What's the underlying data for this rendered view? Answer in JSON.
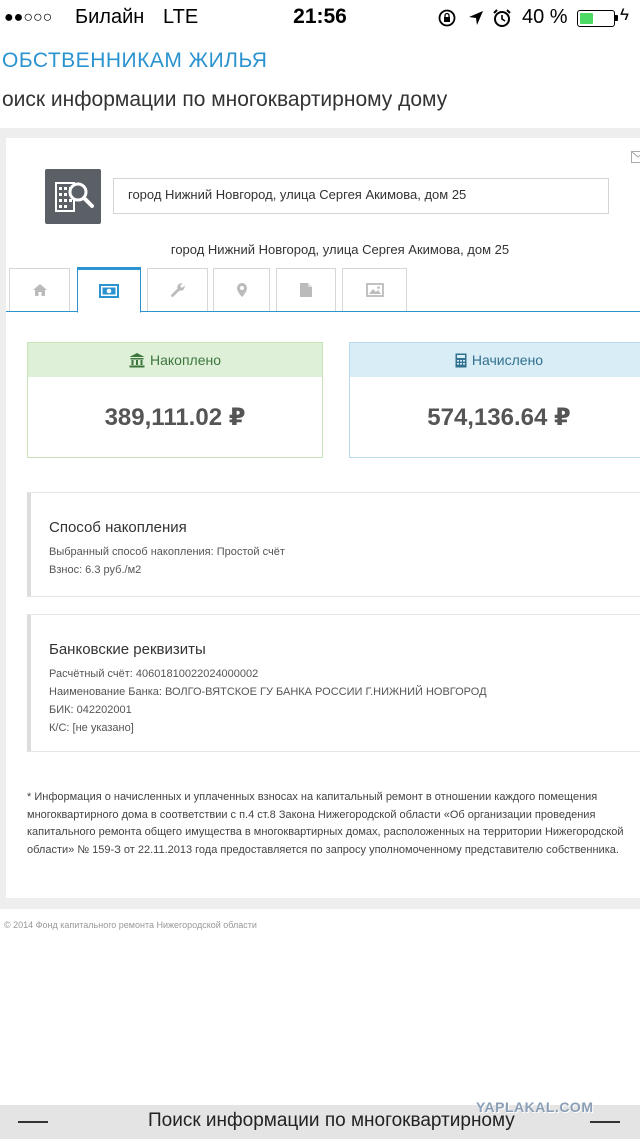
{
  "status_bar": {
    "signal": "●●○○○",
    "carrier": "Билайн",
    "network": "LTE",
    "time": "21:56",
    "icons": [
      "rotation-lock-icon",
      "location-arrow-icon",
      "alarm-icon"
    ],
    "battery_percent_label": "40 %",
    "battery_level": 0.4
  },
  "site_title": "ОБСТВЕННИКАМ ЖИЛЬЯ",
  "page_heading": "оиск информации по многоквартирному дому",
  "search": {
    "value": "город Нижний Новгород, улица Сергея Акимова, дом 25"
  },
  "address_caption": "город Нижний Новгород, улица Сергея Акимова, дом 25",
  "tabs": [
    {
      "icon": "home-icon",
      "active": false
    },
    {
      "icon": "money-icon",
      "active": true
    },
    {
      "icon": "wrench-icon",
      "active": false
    },
    {
      "icon": "map-marker-icon",
      "active": false
    },
    {
      "icon": "document-icon",
      "active": false
    },
    {
      "icon": "image-icon",
      "active": false
    }
  ],
  "stats": {
    "accumulated": {
      "label": "Накоплено",
      "value": "389,111.02 ₽",
      "icon": "bank-icon"
    },
    "charged": {
      "label": "Начислено",
      "value": "574,136.64 ₽",
      "icon": "calculator-icon"
    }
  },
  "accumulation": {
    "title": "Способ накопления",
    "lines": [
      "Выбранный способ накопления: Простой счёт",
      "Взнос: 6.3 руб./м2"
    ]
  },
  "bank": {
    "title": "Банковские реквизиты",
    "lines": [
      "Расчётный счёт: 40601810022024000002",
      "Наименование Банка: ВОЛГО-ВЯТСКОЕ ГУ БАНКА РОССИИ Г.НИЖНИЙ НОВГОРОД",
      "БИК: 042202001",
      "К/С: [не указано]"
    ]
  },
  "footnote": "* Информация о начисленных и уплаченных взносах на капитальный ремонт в отношении каждого помещения многоквартирного дома в соответствии с п.4 ст.8 Закона Нижегородской области «Об организации проведения капитального ремонта общего имущества в многоквартирных домах, расположенных на территории Нижегородской области» № 159-З от 22.11.2013 года предоставляется по запросу уполномоченному представителю собственника.",
  "copyright": "© 2014 Фонд капитального ремонта Нижегородской области",
  "bottom_bar": {
    "title": "Поиск информации по многоквартирному"
  },
  "watermark": "YAPLAKAL.COM",
  "colors": {
    "accent": "#2a93d0",
    "success_bg": "#dff0d8",
    "success_text": "#3c763d",
    "info_bg": "#d9edf7",
    "info_text": "#31708f"
  }
}
